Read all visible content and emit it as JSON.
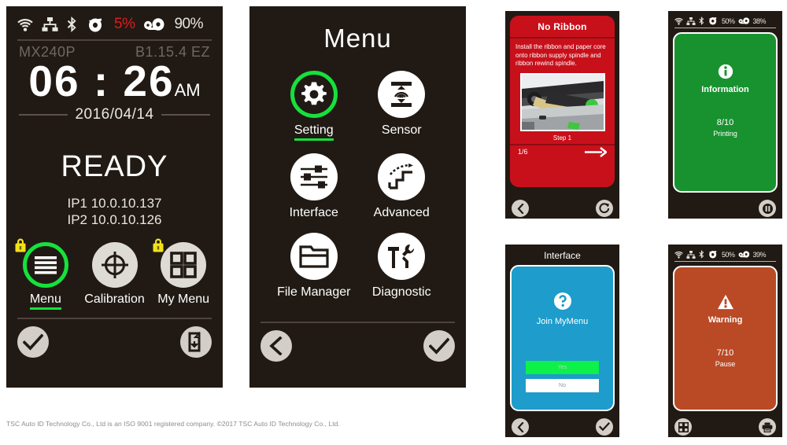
{
  "footer": {
    "copyright": "TSC Auto ID Technology Co., Ltd is an ISO 9001 registered company. ©2017 TSC Auto ID Technology Co., Ltd."
  },
  "panel_ready": {
    "statusbar": {
      "wifi_icon": "wifi-icon",
      "ethernet_icon": "ethernet-icon",
      "bluetooth_icon": "bluetooth-icon",
      "ribbon_icon": "ribbon-roll-icon",
      "ribbon_value": "5%",
      "media_icon": "media-roll-icon",
      "media_value": "90%"
    },
    "model": "MX240P",
    "firmware": "B1.15.4 EZ",
    "time": "06 : 26",
    "ampm": "AM",
    "date": "2016/04/14",
    "status": "READY",
    "ip1": "IP1 10.0.10.137",
    "ip2": "IP2 10.0.10.126",
    "shortcuts": [
      {
        "label": "Menu",
        "icon": "hamburger-menu-icon",
        "selected": true,
        "locked": true
      },
      {
        "label": "Calibration",
        "icon": "crosshair-icon",
        "selected": false,
        "locked": false
      },
      {
        "label": "My Menu",
        "icon": "grid-four-icon",
        "selected": false,
        "locked": true
      }
    ],
    "footer_buttons": [
      {
        "name": "confirm-button",
        "icon": "check-icon"
      },
      {
        "name": "feed-label-button",
        "icon": "label-feed-icon"
      }
    ]
  },
  "panel_menu": {
    "title": "Menu",
    "items": [
      {
        "label": "Setting",
        "icon": "gear-icon",
        "selected": true
      },
      {
        "label": "Sensor",
        "icon": "sensor-icon",
        "selected": false
      },
      {
        "label": "Interface",
        "icon": "sliders-icon",
        "selected": false
      },
      {
        "label": "Advanced",
        "icon": "stairs-icon",
        "selected": false
      },
      {
        "label": "File Manager",
        "icon": "folder-icon",
        "selected": false
      },
      {
        "label": "Diagnostic",
        "icon": "tools-icon",
        "selected": false
      }
    ],
    "footer_buttons": [
      {
        "name": "back-button",
        "icon": "chevron-left-icon"
      },
      {
        "name": "confirm-button",
        "icon": "check-icon"
      }
    ]
  },
  "panel_no_ribbon": {
    "title": "No Ribbon",
    "body": "Install the ribbon and paper core onto ribbon supply spindle and ribbon rewind spindle.",
    "photo_caption": "Step 1",
    "page_indicator": "1/6",
    "next_icon": "arrow-right-icon",
    "footer_buttons": [
      {
        "name": "back-button",
        "icon": "chevron-left-icon"
      },
      {
        "name": "reload-button",
        "icon": "refresh-icon"
      }
    ]
  },
  "panel_interface": {
    "title": "Interface",
    "question_icon": "question-mark-icon",
    "question": "Join MyMenu",
    "options": [
      {
        "label": "Yes",
        "selected": true
      },
      {
        "label": "No",
        "selected": false
      }
    ],
    "footer_buttons": [
      {
        "name": "back-button",
        "icon": "chevron-left-icon"
      },
      {
        "name": "confirm-button",
        "icon": "check-icon"
      }
    ]
  },
  "panel_information": {
    "statusbar": {
      "wifi_icon": "wifi-icon",
      "ethernet_icon": "ethernet-icon",
      "bluetooth_icon": "bluetooth-icon",
      "ribbon_icon": "ribbon-roll-icon",
      "ribbon_value": "50%",
      "media_icon": "media-roll-icon",
      "media_value": "38%"
    },
    "icon": "information-icon",
    "title": "Information",
    "count": "8/10",
    "state": "Printing",
    "footer_buttons": [
      {
        "name": "pause-button",
        "icon": "pause-icon"
      }
    ]
  },
  "panel_warning": {
    "statusbar": {
      "wifi_icon": "wifi-icon",
      "ethernet_icon": "ethernet-icon",
      "bluetooth_icon": "bluetooth-icon",
      "ribbon_icon": "ribbon-roll-icon",
      "ribbon_value": "50%",
      "media_icon": "media-roll-icon",
      "media_value": "39%"
    },
    "icon": "warning-triangle-icon",
    "title": "Warning",
    "count": "7/10",
    "state": "Pause",
    "footer_buttons": [
      {
        "name": "my-menu-button",
        "icon": "grid-four-icon"
      },
      {
        "name": "print-button",
        "icon": "printer-icon"
      }
    ]
  },
  "colors": {
    "device_bg": "#211a14",
    "accent_green": "#16e13c",
    "alert_red": "#c8101b",
    "info_green": "#18922f",
    "warn_orange": "#ba4a25",
    "dialog_blue": "#1e9ccb",
    "lock_yellow": "#f2e117"
  }
}
